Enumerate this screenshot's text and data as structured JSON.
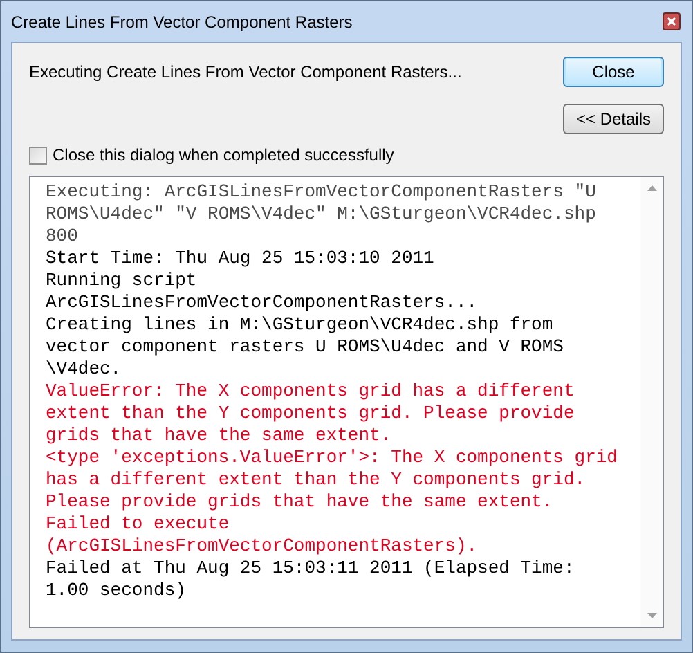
{
  "window": {
    "title": "Create Lines From Vector Component Rasters"
  },
  "status": "Executing Create Lines From Vector Component Rasters...",
  "buttons": [
    {
      "label": "Close",
      "focused": true
    },
    {
      "label": "<< Details",
      "focused": false
    }
  ],
  "checkbox": {
    "label": "Close this dialog when completed successfully",
    "checked": false
  },
  "log": [
    {
      "kind": "normal",
      "text": "Executing: ArcGISLinesFromVectorComponentRasters \"U"
    },
    {
      "kind": "normal",
      "text": "ROMS\\U4dec\" \"V ROMS\\V4dec\" M:\\GSturgeon\\VCR4dec.shp"
    },
    {
      "kind": "normal",
      "text": "800"
    },
    {
      "kind": "info",
      "text": "Start Time: Thu Aug 25 15:03:10 2011"
    },
    {
      "kind": "info",
      "text": "Running script"
    },
    {
      "kind": "info",
      "text": "ArcGISLinesFromVectorComponentRasters..."
    },
    {
      "kind": "info",
      "text": "Creating lines in M:\\GSturgeon\\VCR4dec.shp from"
    },
    {
      "kind": "info",
      "text": "vector component rasters U ROMS\\U4dec and V ROMS"
    },
    {
      "kind": "info",
      "text": "\\V4dec."
    },
    {
      "kind": "error",
      "text": "ValueError: The X components grid has a different"
    },
    {
      "kind": "error",
      "text": "extent than the Y components grid. Please provide"
    },
    {
      "kind": "error",
      "text": "grids that have the same extent."
    },
    {
      "kind": "error",
      "text": "<type 'exceptions.ValueError'>: The X components grid"
    },
    {
      "kind": "error",
      "text": "has a different extent than the Y components grid."
    },
    {
      "kind": "error",
      "text": "Please provide grids that have the same extent."
    },
    {
      "kind": "error",
      "text": "Failed to execute"
    },
    {
      "kind": "error",
      "text": "(ArcGISLinesFromVectorComponentRasters)."
    },
    {
      "kind": "info",
      "text": "Failed at Thu Aug 25 15:03:11 2011 (Elapsed Time:"
    },
    {
      "kind": "info",
      "text": "1.00 seconds)"
    }
  ]
}
